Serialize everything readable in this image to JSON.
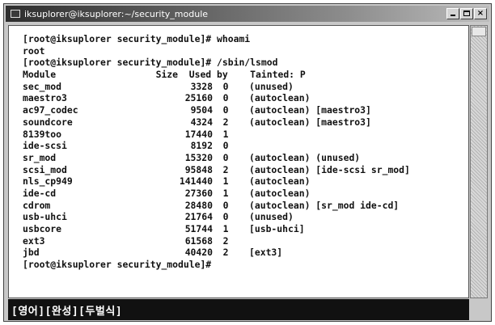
{
  "window": {
    "title": "iksuplorer@iksuplorer:~/security_module",
    "icon": "terminal-icon",
    "controls": [
      "minimize",
      "maximize",
      "close"
    ]
  },
  "terminal": {
    "lines_before": [
      "[root@iksuplorer security_module]# whoami",
      "root",
      "[root@iksuplorer security_module]# /sbin/lsmod",
      "Module                  Size  Used by    Tainted: P"
    ],
    "modules": [
      {
        "name": "sec_mod",
        "size": "3328",
        "used": "0",
        "by": "(unused)"
      },
      {
        "name": "maestro3",
        "size": "25160",
        "used": "0",
        "by": "(autoclean)"
      },
      {
        "name": "ac97_codec",
        "size": "9504",
        "used": "0",
        "by": "(autoclean) [maestro3]"
      },
      {
        "name": "soundcore",
        "size": "4324",
        "used": "2",
        "by": "(autoclean) [maestro3]"
      },
      {
        "name": "8139too",
        "size": "17440",
        "used": "1",
        "by": ""
      },
      {
        "name": "ide-scsi",
        "size": "8192",
        "used": "0",
        "by": ""
      },
      {
        "name": "sr_mod",
        "size": "15320",
        "used": "0",
        "by": "(autoclean) (unused)"
      },
      {
        "name": "scsi_mod",
        "size": "95848",
        "used": "2",
        "by": "(autoclean) [ide-scsi sr_mod]"
      },
      {
        "name": "nls_cp949",
        "size": "141440",
        "used": "1",
        "by": "(autoclean)"
      },
      {
        "name": "ide-cd",
        "size": "27360",
        "used": "1",
        "by": "(autoclean)"
      },
      {
        "name": "cdrom",
        "size": "28480",
        "used": "0",
        "by": "(autoclean) [sr_mod ide-cd]"
      },
      {
        "name": "usb-uhci",
        "size": "21764",
        "used": "0",
        "by": "(unused)"
      },
      {
        "name": "usbcore",
        "size": "51744",
        "used": "1",
        "by": "[usb-uhci]"
      },
      {
        "name": "ext3",
        "size": "61568",
        "used": "2",
        "by": ""
      },
      {
        "name": "jbd",
        "size": "40420",
        "used": "2",
        "by": "[ext3]"
      }
    ],
    "prompt_final": "[root@iksuplorer security_module]#"
  },
  "status_bar": {
    "ime": "[영어][완성][두벌식]"
  }
}
